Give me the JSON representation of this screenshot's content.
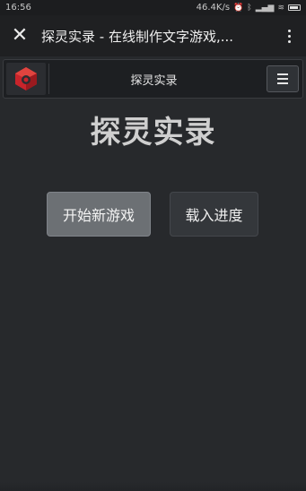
{
  "status_bar": {
    "time": "16:56",
    "network_speed": "46.4K/s"
  },
  "browser": {
    "title": "探灵实录 - 在线制作文字游戏,...",
    "close_icon": "close-icon",
    "more_icon": "more-vertical-icon"
  },
  "app_nav": {
    "logo_icon": "app-logo-icon",
    "title": "探灵实录",
    "menu_icon": "hamburger-menu-icon"
  },
  "main": {
    "title": "探灵实录",
    "buttons": {
      "new_game": "开始新游戏",
      "load_game": "载入进度"
    }
  },
  "colors": {
    "background": "#27292c",
    "nav_background": "#1d1f22",
    "primary_button": "#6c7074",
    "secondary_button": "#34373b",
    "logo_red": "#c8242b"
  }
}
